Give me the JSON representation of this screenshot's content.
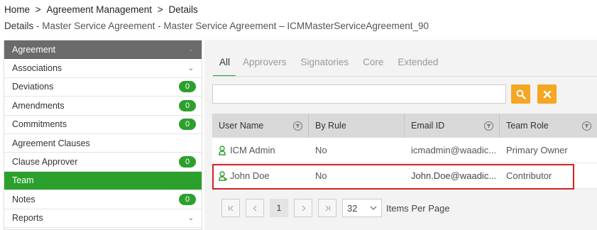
{
  "breadcrumb": [
    "Home",
    "Agreement Management",
    "Details"
  ],
  "breadcrumb_sep": ">",
  "details": {
    "label": "Details",
    "rest": " - Master Service Agreement - Master Service Agreement – ICMMasterServiceAgreement_90"
  },
  "sidebar": {
    "items": [
      {
        "label": "Agreement",
        "badge": "",
        "chevron": "⌄"
      },
      {
        "label": "Associations",
        "badge": "",
        "chevron": "⌄"
      },
      {
        "label": "Deviations",
        "badge": "0",
        "chevron": ""
      },
      {
        "label": "Amendments",
        "badge": "0",
        "chevron": ""
      },
      {
        "label": "Commitments",
        "badge": "0",
        "chevron": ""
      },
      {
        "label": "Agreement Clauses",
        "badge": "",
        "chevron": ""
      },
      {
        "label": "Clause Approver",
        "badge": "0",
        "chevron": ""
      },
      {
        "label": "Team",
        "badge": "",
        "chevron": ""
      },
      {
        "label": "Notes",
        "badge": "0",
        "chevron": ""
      },
      {
        "label": "Reports",
        "badge": "",
        "chevron": "⌄"
      }
    ]
  },
  "tabs": [
    "All",
    "Approvers",
    "Signatories",
    "Core",
    "Extended"
  ],
  "grid": {
    "columns": [
      "User Name",
      "By Rule",
      "Email ID",
      "Team Role"
    ],
    "rows": [
      [
        "ICM Admin",
        "No",
        "icmadmin@waadic...",
        "Primary Owner"
      ],
      [
        "John Doe",
        "No",
        "John.Doe@waadic...",
        "Contributor"
      ]
    ]
  },
  "pager": {
    "page": "1",
    "page_size": "32",
    "items_label": "Items Per Page"
  },
  "colors": {
    "accent_green": "#2ca02c",
    "button_orange": "#f5a623",
    "highlight_red": "#d62020"
  }
}
